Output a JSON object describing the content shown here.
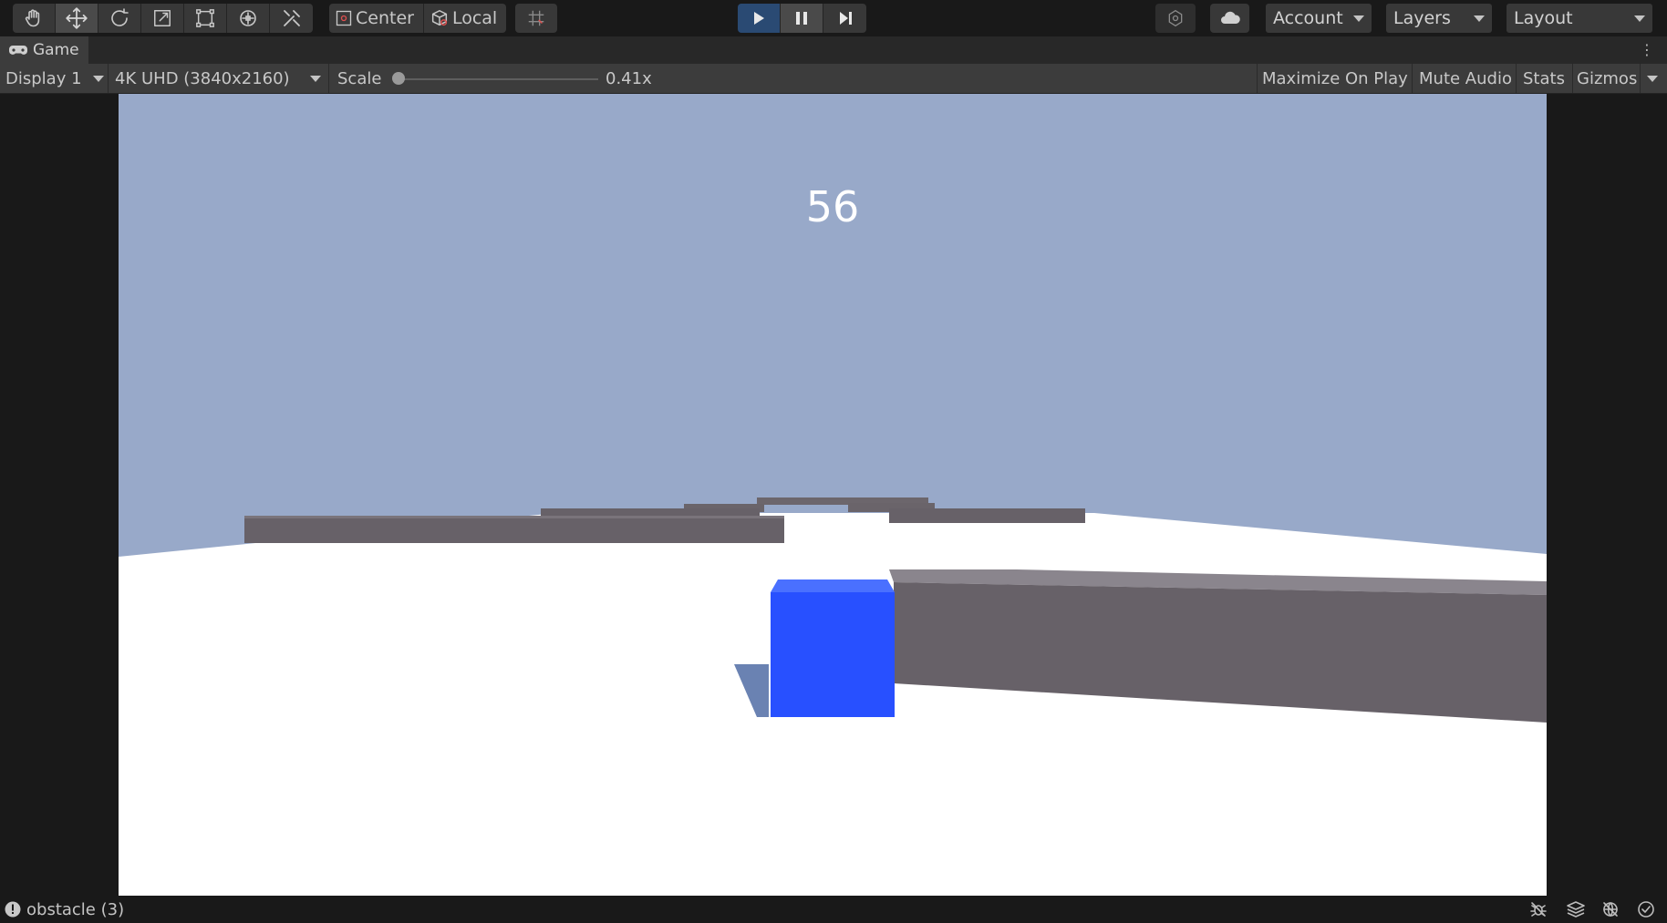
{
  "toolbar": {
    "tools": [
      "hand-tool-icon",
      "move-tool-icon",
      "rotate-tool-icon",
      "scale-tool-icon",
      "rect-tool-icon",
      "transform-tool-icon",
      "custom-tool-icon"
    ],
    "pivot_mode_label": "Center",
    "pivot_rotation_label": "Local",
    "play": {
      "play_icon": "play-icon",
      "pause_icon": "pause-icon",
      "step_icon": "step-icon"
    },
    "account_label": "Account",
    "layers_label": "Layers",
    "layout_label": "Layout"
  },
  "game_tab": {
    "label": "Game",
    "icon": "gamepad-icon"
  },
  "game_controls": {
    "display_label": "Display 1",
    "resolution_label": "4K UHD (3840x2160)",
    "scale_label": "Scale",
    "scale_value": "0.41x",
    "maximize_label": "Maximize On Play",
    "mute_label": "Mute Audio",
    "stats_label": "Stats",
    "gizmos_label": "Gizmos"
  },
  "game_view": {
    "score": "56",
    "colors": {
      "sky": "#98a9c9",
      "ground": "#ffffff",
      "obstacle": "#676168",
      "player": "#2850ff"
    }
  },
  "statusbar": {
    "message": "obstacle (3)",
    "icons": [
      "debug-off-icon",
      "layers-stack-icon",
      "network-off-icon",
      "check-circle-icon"
    ]
  }
}
